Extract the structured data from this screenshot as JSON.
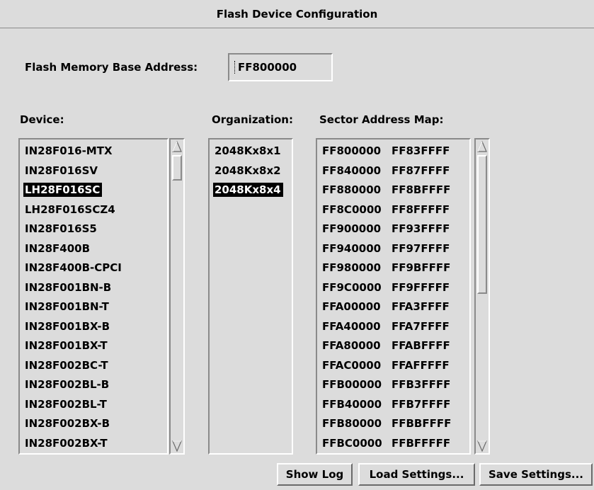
{
  "window": {
    "title": "Flash Device Configuration"
  },
  "base_address": {
    "label": "Flash Memory Base Address:",
    "value": "FF800000"
  },
  "device": {
    "label": "Device:",
    "items": [
      "IN28F016-MTX",
      "IN28F016SV",
      "LH28F016SC",
      "LH28F016SCZ4",
      "IN28F016S5",
      "IN28F400B",
      "IN28F400B-CPCI",
      "IN28F001BN-B",
      "IN28F001BN-T",
      "IN28F001BX-B",
      "IN28F001BX-T",
      "IN28F002BC-T",
      "IN28F002BL-B",
      "IN28F002BL-T",
      "IN28F002BX-B",
      "IN28F002BX-T"
    ],
    "selected_index": 2
  },
  "organization": {
    "label": "Organization:",
    "items": [
      "2048Kx8x1",
      "2048Kx8x2",
      "2048Kx8x4"
    ],
    "selected_index": 2
  },
  "sector_map": {
    "label": "Sector Address Map:",
    "rows": [
      [
        "FF800000",
        "FF83FFFF"
      ],
      [
        "FF840000",
        "FF87FFFF"
      ],
      [
        "FF880000",
        "FF8BFFFF"
      ],
      [
        "FF8C0000",
        "FF8FFFFF"
      ],
      [
        "FF900000",
        "FF93FFFF"
      ],
      [
        "FF940000",
        "FF97FFFF"
      ],
      [
        "FF980000",
        "FF9BFFFF"
      ],
      [
        "FF9C0000",
        "FF9FFFFF"
      ],
      [
        "FFA00000",
        "FFA3FFFF"
      ],
      [
        "FFA40000",
        "FFA7FFFF"
      ],
      [
        "FFA80000",
        "FFABFFFF"
      ],
      [
        "FFAC0000",
        "FFAFFFFF"
      ],
      [
        "FFB00000",
        "FFB3FFFF"
      ],
      [
        "FFB40000",
        "FFB7FFFF"
      ],
      [
        "FFB80000",
        "FFBBFFFF"
      ],
      [
        "FFBC0000",
        "FFBFFFFF"
      ]
    ]
  },
  "buttons": {
    "show_log": "Show Log",
    "load_settings": "Load Settings...",
    "save_settings": "Save Settings..."
  },
  "colors": {
    "background": "#dcdcdc",
    "selection": "#000000"
  }
}
